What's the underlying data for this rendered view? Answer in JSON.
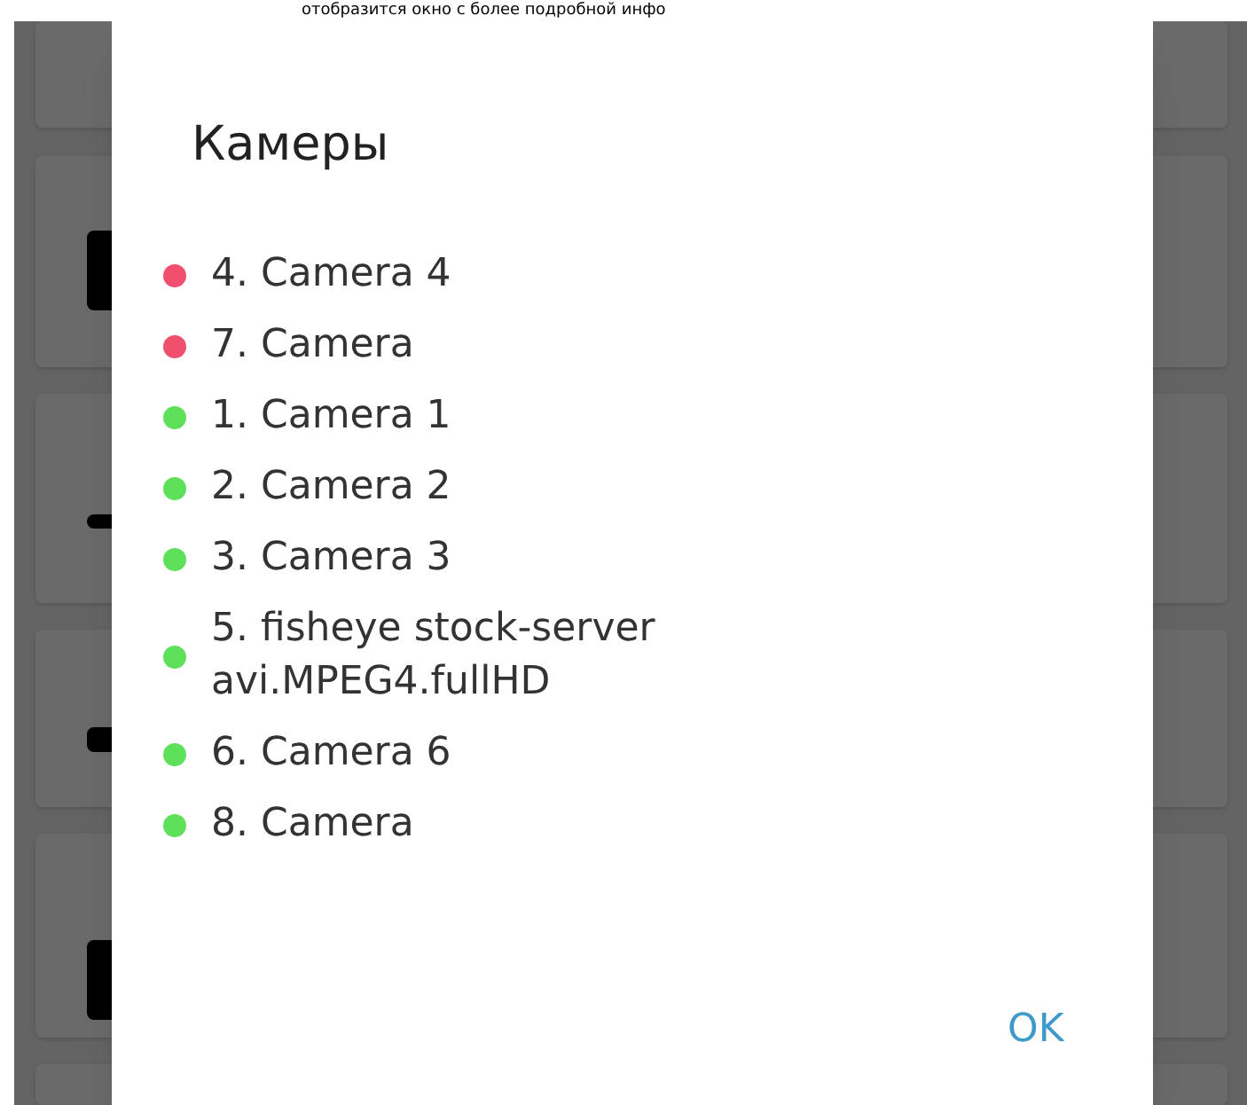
{
  "caption": "отобразится окно с более подробной инфо",
  "dialog": {
    "title": "Камеры",
    "cameras": [
      {
        "name": "4. Camera 4",
        "color": "#f0506e"
      },
      {
        "name": "7. Camera",
        "color": "#f0506e"
      },
      {
        "name": "1. Camera 1",
        "color": "#5ee05a"
      },
      {
        "name": "2. Camera 2",
        "color": "#5ee05a"
      },
      {
        "name": "3. Camera 3",
        "color": "#5ee05a"
      },
      {
        "name": "5. fisheye stock-server avi.MPEG4.fullHD",
        "color": "#5ee05a"
      },
      {
        "name": "6. Camera 6",
        "color": "#5ee05a"
      },
      {
        "name": "8. Camera",
        "color": "#5ee05a"
      }
    ],
    "button": "OK"
  }
}
